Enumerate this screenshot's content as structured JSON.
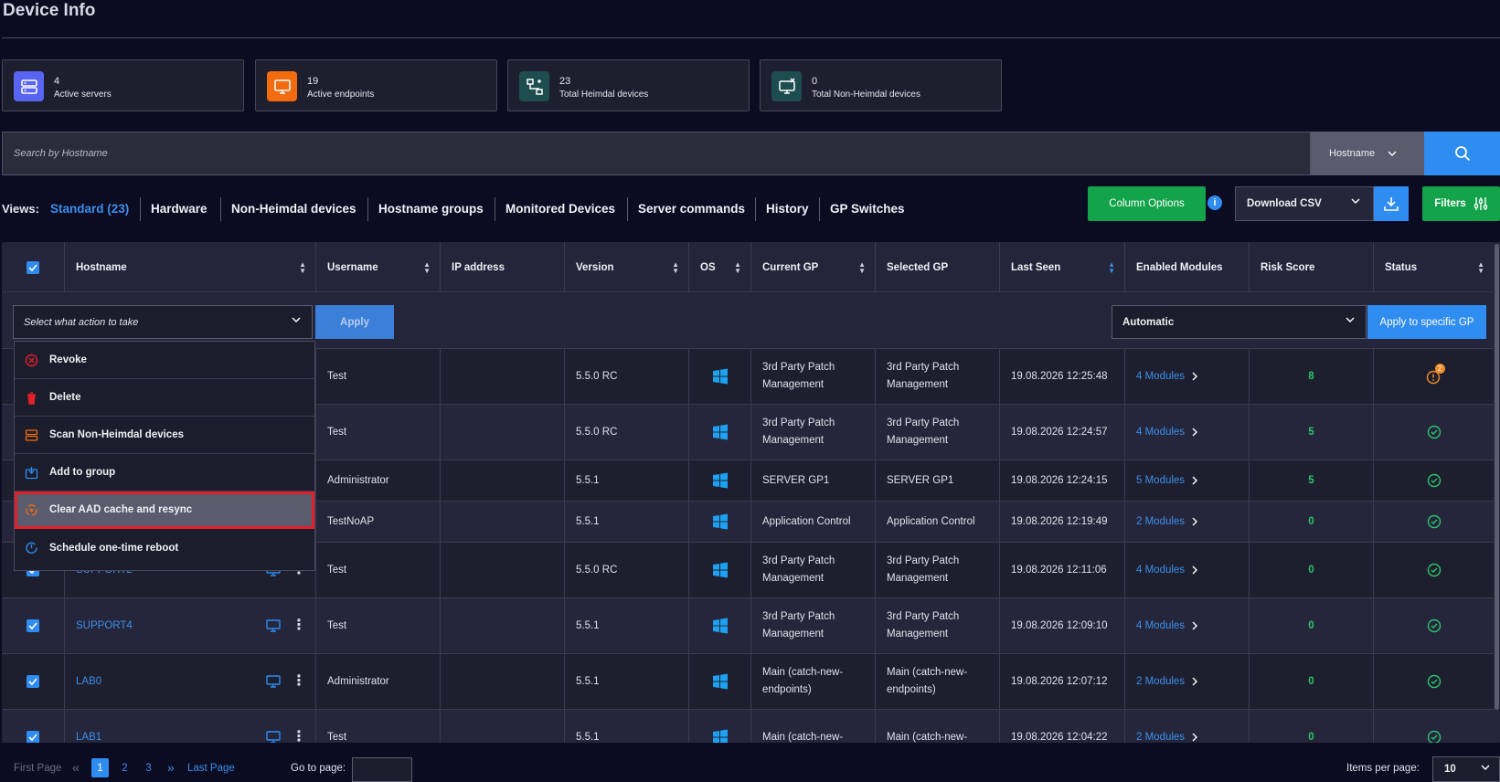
{
  "page": {
    "title": "Device Info"
  },
  "stats": [
    {
      "value": "4",
      "label": "Active servers",
      "icon": "server-icon",
      "color": "#5865f2"
    },
    {
      "value": "19",
      "label": "Active endpoints",
      "icon": "monitor-icon",
      "color": "#f26b0f"
    },
    {
      "value": "23",
      "label": "Total Heimdal devices",
      "icon": "network-icon",
      "color": "#1e4d4f"
    },
    {
      "value": "0",
      "label": "Total Non-Heimdal devices",
      "icon": "monitor-x-icon",
      "color": "#1e4d4f"
    }
  ],
  "search": {
    "placeholder": "Search by Hostname",
    "type": "Hostname"
  },
  "views": {
    "label": "Views:",
    "tabs": [
      {
        "label": "Standard (23)",
        "active": true
      },
      {
        "label": "Hardware"
      },
      {
        "label": "Non-Heimdal devices"
      },
      {
        "label": "Hostname groups"
      },
      {
        "label": "Monitored Devices"
      },
      {
        "label": "Server commands"
      },
      {
        "label": "History"
      },
      {
        "label": "GP Switches"
      }
    ]
  },
  "toolbar": {
    "column_options": "Column Options",
    "download": "Download CSV",
    "filters": "Filters",
    "info": "i"
  },
  "table": {
    "columns": [
      "Hostname",
      "Username",
      "IP address",
      "Version",
      "OS",
      "Current GP",
      "Selected GP",
      "Last Seen",
      "Enabled Modules",
      "Risk Score",
      "Status"
    ],
    "action_placeholder": "Select what action to take",
    "apply": "Apply",
    "gp_option": "Automatic",
    "apply_gp": "Apply to specific GP",
    "rows": [
      {
        "hostname": "",
        "username": "Test",
        "ip": "",
        "version": "5.5.0 RC",
        "current_gp": "3rd Party Patch Management",
        "selected_gp": "3rd Party Patch Management",
        "last_seen": "19.08.2026  12:25:48",
        "modules": "4 Modules",
        "risk": "8",
        "status": "warning",
        "status_count": "2"
      },
      {
        "hostname": "",
        "username": "Test",
        "ip": "",
        "version": "5.5.0 RC",
        "current_gp": "3rd Party Patch Management",
        "selected_gp": "3rd Party Patch Management",
        "last_seen": "19.08.2026  12:24:57",
        "modules": "4 Modules",
        "risk": "5",
        "status": "ok"
      },
      {
        "hostname": "",
        "username": "Administrator",
        "ip": "",
        "version": "5.5.1",
        "current_gp": "SERVER GP1",
        "selected_gp": "SERVER GP1",
        "last_seen": "19.08.2026  12:24:15",
        "modules": "5 Modules",
        "risk": "5",
        "status": "ok"
      },
      {
        "hostname": "",
        "username": "TestNoAP",
        "ip": "",
        "version": "5.5.1",
        "current_gp": "Application Control",
        "selected_gp": "Application Control",
        "last_seen": "19.08.2026  12:19:49",
        "modules": "2 Modules",
        "risk": "0",
        "status": "ok"
      },
      {
        "hostname": "SUPPORT2",
        "username": "Test",
        "ip": "",
        "version": "5.5.0 RC",
        "current_gp": "3rd Party Patch Management",
        "selected_gp": "3rd Party Patch Management",
        "last_seen": "19.08.2026  12:11:06",
        "modules": "4 Modules",
        "risk": "0",
        "status": "ok"
      },
      {
        "hostname": "SUPPORT4",
        "username": "Test",
        "ip": "",
        "version": "5.5.1",
        "current_gp": "3rd Party Patch Management",
        "selected_gp": "3rd Party Patch Management",
        "last_seen": "19.08.2026  12:09:10",
        "modules": "4 Modules",
        "risk": "0",
        "status": "ok"
      },
      {
        "hostname": "LAB0",
        "username": "Administrator",
        "ip": "",
        "version": "5.5.1",
        "current_gp": "Main (catch-new-endpoints)",
        "selected_gp": "Main (catch-new-endpoints)",
        "last_seen": "19.08.2026  12:07:12",
        "modules": "2 Modules",
        "risk": "0",
        "status": "ok"
      },
      {
        "hostname": "LAB1",
        "username": "Test",
        "ip": "",
        "version": "5.5.1",
        "current_gp": "Main (catch-new-",
        "selected_gp": "Main (catch-new-",
        "last_seen": "19.08.2026  12:04:22",
        "modules": "2 Modules",
        "risk": "0",
        "status": "ok"
      }
    ]
  },
  "dropdown": {
    "items": [
      {
        "label": "Revoke",
        "icon": "revoke-icon"
      },
      {
        "label": "Delete",
        "icon": "trash-icon"
      },
      {
        "label": "Scan Non-Heimdal devices",
        "icon": "scan-icon"
      },
      {
        "label": "Add to group",
        "icon": "add-group-icon"
      },
      {
        "label": "Clear AAD cache and resync",
        "icon": "resync-icon",
        "highlighted": true
      },
      {
        "label": "Schedule one-time reboot",
        "icon": "reboot-icon"
      }
    ]
  },
  "pagination": {
    "first": "First Page",
    "pages": [
      "1",
      "2",
      "3"
    ],
    "current": "1",
    "last": "Last Page",
    "goto": "Go to page:",
    "items_per_page_label": "Items per page:",
    "items_per_page": "10"
  },
  "colors": {
    "accent": "#2f8cf0",
    "green": "#13a34a",
    "highlight_border": "#e3202a",
    "background": "#0b0b22"
  }
}
